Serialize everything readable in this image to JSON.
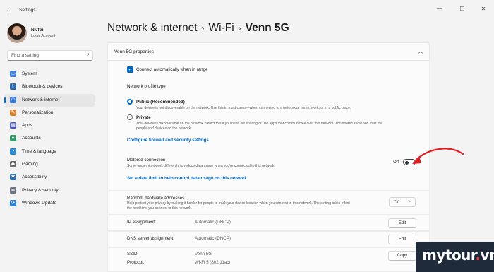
{
  "window": {
    "title": "Settings",
    "back_glyph": "←",
    "minimize_glyph": "—",
    "maximize_glyph": "☐",
    "close_glyph": "✕"
  },
  "profile": {
    "name": "Nr.Tai",
    "account": "Local Account"
  },
  "search": {
    "placeholder": "Find a setting",
    "icon": "search-icon"
  },
  "nav": {
    "items": [
      {
        "label": "System",
        "icon": "monitor-icon",
        "color": "#3a7bd5"
      },
      {
        "label": "Bluetooth & devices",
        "icon": "bluetooth-icon",
        "color": "#2b6cb0"
      },
      {
        "label": "Network & internet",
        "icon": "wifi-icon",
        "color": "#3a7bd5",
        "active": true
      },
      {
        "label": "Personalization",
        "icon": "brush-icon",
        "color": "#d9822b"
      },
      {
        "label": "Apps",
        "icon": "apps-icon",
        "color": "#4a5bbf"
      },
      {
        "label": "Accounts",
        "icon": "person-icon",
        "color": "#2e9e6b"
      },
      {
        "label": "Time & language",
        "icon": "globe-clock-icon",
        "color": "#2a8ad4"
      },
      {
        "label": "Gaming",
        "icon": "gamepad-icon",
        "color": "#6b6b6b"
      },
      {
        "label": "Accessibility",
        "icon": "accessibility-icon",
        "color": "#2a6fb8"
      },
      {
        "label": "Privacy & security",
        "icon": "shield-icon",
        "color": "#6b7280"
      },
      {
        "label": "Windows Update",
        "icon": "update-icon",
        "color": "#2a7fd4"
      }
    ]
  },
  "breadcrumb": {
    "part1": "Network & internet",
    "part2": "Wi-Fi",
    "current": "Venn 5G",
    "sep": "›"
  },
  "properties": {
    "header": "Venn 5G properties",
    "connect_auto": "Connect automatically when in range",
    "profile_type_label": "Network profile type",
    "public_title": "Public (Recommended)",
    "public_desc": "Your device is not discoverable on the network. Use this in most cases—when connected to a network at home, work, or in a public place.",
    "private_title": "Private",
    "private_desc_1": "Your device is discoverable on the network. Select this if you need file sharing or use apps that communicate over this network. You should know and trust the",
    "private_desc_2": "people and devices on the network.",
    "firewall_link": "Configure firewall and security settings",
    "metered_title": "Metered connection",
    "metered_desc": "Some apps might work differently to reduce data usage when you're connected to this network",
    "metered_state": "Off",
    "data_limit_link": "Set a data limit to help control data usage on this network",
    "random_hw_title": "Random hardware addresses",
    "random_hw_desc_1": "Help protect your privacy by making it harder for people to track your device location when you connect to this network. The setting takes effect",
    "random_hw_desc_2": "the next time you connect to this network.",
    "random_hw_value": "Off",
    "ip_label": "IP assignment:",
    "ip_value": "Automatic (DHCP)",
    "dns_label": "DNS server assignment:",
    "dns_value": "Automatic (DHCP)",
    "edit_label": "Edit",
    "ssid_label": "SSID:",
    "ssid_value": "Venn 5G",
    "protocol_label": "Protocol:",
    "protocol_value": "Wi-Fi 5 (802.11ac)",
    "copy_label": "Copy"
  },
  "annotation": {
    "arrow_color": "#e02020"
  },
  "watermark": {
    "text_main": "mytour",
    "text_dot": ".",
    "text_tld": "vn"
  }
}
